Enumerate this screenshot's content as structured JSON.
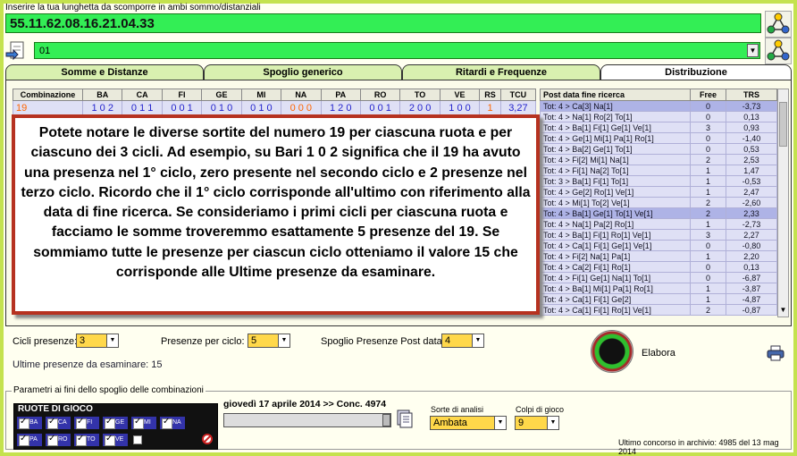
{
  "header": {
    "hint": "Inserire la tua lunghetta da scomporre in ambi sommo/distanziali",
    "numbers": "55.11.62.08.16.21.04.33",
    "dropdown_value": "01"
  },
  "tabs": [
    "Somme e Distanze",
    "Spoglio generico",
    "Ritardi e Frequenze",
    "Distribuzione"
  ],
  "left_table": {
    "headers": [
      "Combinazione",
      "BA",
      "CA",
      "FI",
      "GE",
      "MI",
      "NA",
      "PA",
      "RO",
      "TO",
      "VE",
      "RS",
      "TCU"
    ],
    "row": [
      "19",
      "1 0 2",
      "0 1 1",
      "0 0 1",
      "0 1 0",
      "0 1 0",
      "0 0 0",
      "1 2 0",
      "0 0 1",
      "2 0 0",
      "1 0 0",
      "1",
      "3,27"
    ]
  },
  "right_table": {
    "headers": [
      "Post data fine ricerca",
      "Free",
      "TRS"
    ],
    "rows": [
      [
        "Tot: 4 > Ca[3] Na[1]",
        "0",
        "-3,73"
      ],
      [
        "Tot: 4 > Na[1] Ro[2] To[1]",
        "0",
        "0,13"
      ],
      [
        "Tot: 4 > Ba[1] Fi[1] Ge[1] Ve[1]",
        "3",
        "0,93"
      ],
      [
        "Tot: 4 > Ge[1] Mi[1] Pa[1] Ro[1]",
        "0",
        "-1,40"
      ],
      [
        "Tot: 4 > Ba[2] Ge[1] To[1]",
        "0",
        "0,53"
      ],
      [
        "Tot: 4 > Fi[2] Mi[1] Na[1]",
        "2",
        "2,53"
      ],
      [
        "Tot: 4 > Fi[1] Na[2] To[1]",
        "1",
        "1,47"
      ],
      [
        "Tot: 3 > Ba[1] Fi[1] To[1]",
        "1",
        "-0,53"
      ],
      [
        "Tot: 4 > Ge[2] Ro[1] Ve[1]",
        "1",
        "2,47"
      ],
      [
        "Tot: 4 > Mi[1] To[2] Ve[1]",
        "2",
        "-2,60"
      ],
      [
        "Tot: 4 > Ba[1] Ge[1] To[1] Ve[1]",
        "2",
        "2,33"
      ],
      [
        "Tot: 4 > Na[1] Pa[2] Ro[1]",
        "1",
        "-2,73"
      ],
      [
        "Tot: 4 > Ba[1] Fi[1] Ro[1] Ve[1]",
        "3",
        "2,27"
      ],
      [
        "Tot: 4 > Ca[1] Fi[1] Ge[1] Ve[1]",
        "0",
        "-0,80"
      ],
      [
        "Tot: 4 > Fi[2] Na[1] Pa[1]",
        "1",
        "2,20"
      ],
      [
        "Tot: 4 > Ca[2] Fi[1] Ro[1]",
        "0",
        "0,13"
      ],
      [
        "Tot: 4 > Fi[1] Ge[1] Na[1] To[1]",
        "0",
        "-6,87"
      ],
      [
        "Tot: 4 > Ba[1] Mi[1] Pa[1] Ro[1]",
        "1",
        "-3,87"
      ],
      [
        "Tot: 4 > Ca[1] Fi[1] Ge[2]",
        "1",
        "-4,87"
      ],
      [
        "Tot: 4 > Ca[1] Fi[1] Ro[1] Ve[1]",
        "2",
        "-0,87"
      ]
    ]
  },
  "overlay_text": "Potete notare le diverse sortite del numero 19 per ciascuna ruota e per ciascuno dei 3 cicli. Ad esempio, su Bari 1 0 2 significa che il 19 ha avuto una presenza nel 1° ciclo, zero presente nel secondo ciclo e 2 presenze nel terzo ciclo. Ricordo che il 1° ciclo corrisponde all'ultimo con riferimento alla data di fine ricerca. Se consideriamo i primi cicli per ciascuna ruota e facciamo le somme troveremmo esattamente 5 presenze del 19. Se sommiamo tutte le presenze per ciascun ciclo otteniamo il valore 15 che corrisponde alle Ultime presenze da esaminare.",
  "controls": {
    "cicli_label": "Cicli presenze:",
    "cicli_value": "3",
    "presenze_label": "Presenze per ciclo:",
    "presenze_value": "5",
    "spoglio_label": "Spoglio Presenze Post data:",
    "spoglio_value": "4",
    "ultime_label": "Ultime presenze da esaminare: 15",
    "elabora_label": "Elabora"
  },
  "params": {
    "legend": "Parametri ai fini dello spoglio delle combinazioni",
    "ruote_title": "RUOTE DI GIOCO",
    "ruote": [
      "BA",
      "CA",
      "FI",
      "GE",
      "MI",
      "NA",
      "PA",
      "RO",
      "TO",
      "VE",
      ""
    ],
    "date_label": "giovedì 17 aprile 2014 >> Conc. 4974",
    "sorte_label": "Sorte di analisi",
    "sorte_value": "Ambata",
    "colpi_label": "Colpi di gioco",
    "colpi_value": "9",
    "ultimo": "Ultimo concorso in archivio: 4985 del 13 mag 2014"
  }
}
